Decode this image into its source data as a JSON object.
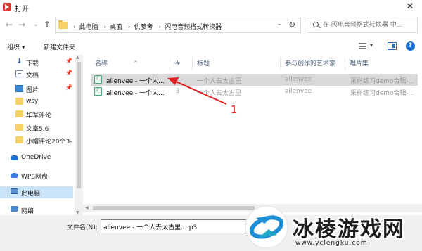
{
  "window": {
    "title": "打开",
    "close_label": "✕"
  },
  "nav_buttons": {
    "back": "←",
    "forward": "→",
    "recent": "⌄",
    "up": "↑"
  },
  "breadcrumb": [
    "此电脑",
    "桌面",
    "供参考",
    "闪电音频格式转换器"
  ],
  "breadcrumb_separator": "›",
  "address_dropdown": "⌄",
  "refresh": "↻",
  "search": {
    "placeholder": "在 闪电音频格式转换器 中..."
  },
  "toolbar": {
    "organize": "组织 ▾",
    "new_folder": "新建文件夹",
    "view_dropdown": "▾",
    "help": "?"
  },
  "nav_pane": {
    "items": [
      {
        "label": "下载",
        "icon": "download-icon",
        "pinned": true
      },
      {
        "label": "文档",
        "icon": "document-icon",
        "pinned": true
      },
      {
        "label": "图片",
        "icon": "picture-icon",
        "pinned": true
      },
      {
        "label": "wsy",
        "icon": "folder-icon",
        "pinned": false
      },
      {
        "label": "华军评论",
        "icon": "folder-icon",
        "pinned": false
      },
      {
        "label": "文章5.6",
        "icon": "folder-icon",
        "pinned": false
      },
      {
        "label": "小帽评论20个3-",
        "icon": "folder-icon",
        "pinned": false
      },
      {
        "label": "OneDrive",
        "icon": "onedrive-cloud-icon",
        "pinned": false
      },
      {
        "label": "WPS网盘",
        "icon": "wps-cloud-icon",
        "pinned": false
      },
      {
        "label": "此电脑",
        "icon": "computer-icon",
        "pinned": false,
        "selected": true
      },
      {
        "label": "网络",
        "icon": "network-icon",
        "pinned": false
      }
    ],
    "pin_glyph": "📌"
  },
  "columns": [
    "名称",
    "#",
    "标题",
    "参与创作的艺术家",
    "唱片集"
  ],
  "sort_indicator": "^",
  "files": [
    {
      "name": "allenvee - 一个人...",
      "number": "3",
      "title": "一个人去太古里",
      "artist": "allenvee",
      "album": "采样练习demo合辑-...",
      "selected": true
    },
    {
      "name": "allenvee - 一个人...",
      "number": "3",
      "title": "一个人去太古里",
      "artist": "allenvee",
      "album": "采样练习demo合辑-...",
      "selected": false
    }
  ],
  "filename": {
    "label": "文件名(N):",
    "value": "allenvee - 一个人去太古里.mp3"
  },
  "annotation": {
    "number": "1",
    "color": "#e02020"
  },
  "watermark": {
    "text": "冰棱游戏网",
    "url": "www.yclengku.com"
  },
  "colors": {
    "selection": "#d9d9d9",
    "nav_selection": "#cce4f7",
    "folder": "#f6d264",
    "accent": "#1c6fd0"
  }
}
